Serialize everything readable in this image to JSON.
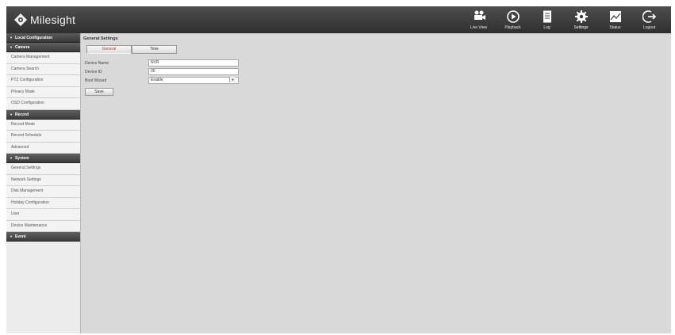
{
  "brand": {
    "name": "Milesight"
  },
  "nav": [
    {
      "label": "Live View",
      "icon": "camera-icon"
    },
    {
      "label": "Playback",
      "icon": "playback-icon"
    },
    {
      "label": "Log",
      "icon": "log-icon"
    },
    {
      "label": "Settings",
      "icon": "gear-icon"
    },
    {
      "label": "Status",
      "icon": "status-icon"
    },
    {
      "label": "Logout",
      "icon": "logout-icon"
    }
  ],
  "sidebar": {
    "title": "Local Configuration",
    "sections": [
      {
        "label": "Camera",
        "items": [
          "Camera Management",
          "Camera Search",
          "PTZ Configuration",
          "Privacy Mask",
          "OSD Configuration"
        ]
      },
      {
        "label": "Record",
        "items": [
          "Record Mode",
          "Record Schedule",
          "Advanced"
        ]
      },
      {
        "label": "System",
        "items": [
          "General Settings",
          "Network Settings",
          "Disk Management",
          "Holiday Configuration",
          "User",
          "Device Maintenance"
        ]
      },
      {
        "label": "Event",
        "items": []
      }
    ]
  },
  "main": {
    "title": "General Settings",
    "tabs": [
      "General",
      "Time"
    ],
    "fields": {
      "device_name_label": "Device Name",
      "device_name_value": "NVR",
      "device_id_label": "Device ID",
      "device_id_value": "00",
      "boot_wizard_label": "Boot Wizard",
      "boot_wizard_value": "Enable"
    },
    "save_label": "Save"
  },
  "colors": {
    "active_tab_text": "#c0392b",
    "header_dark": "#2f2f2f"
  }
}
